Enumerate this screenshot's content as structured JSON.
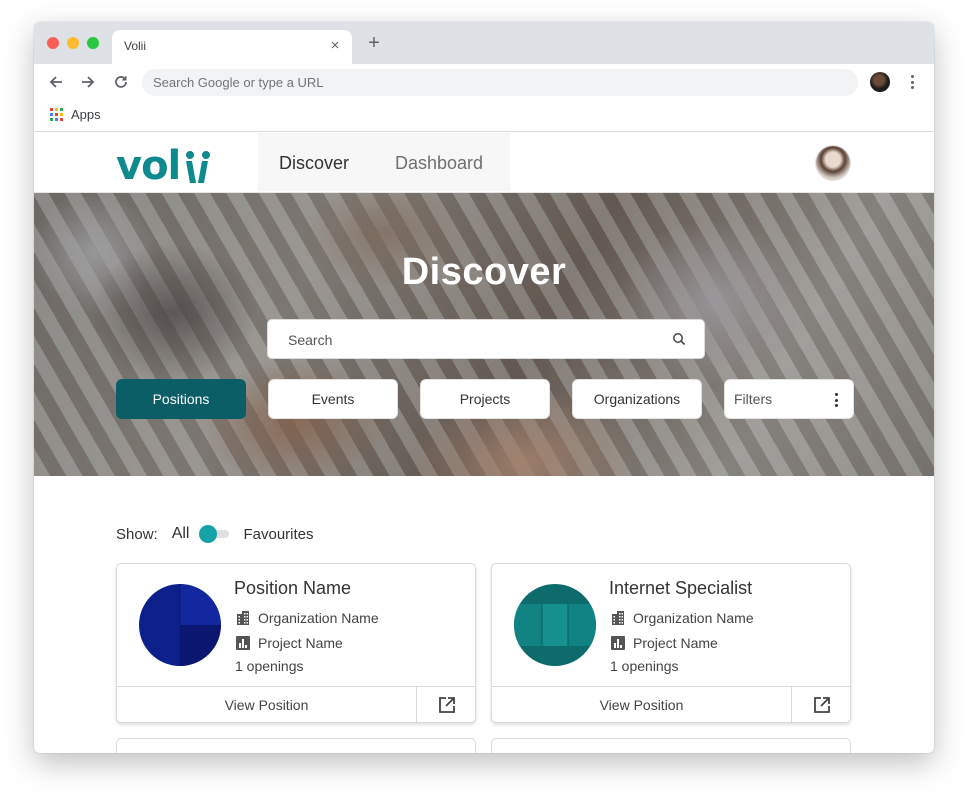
{
  "browser": {
    "tab_title": "Volii",
    "tab_close": "×",
    "new_tab": "+",
    "omnibox_placeholder": "Search Google or type a URL",
    "bookmarks": {
      "apps_label": "Apps"
    }
  },
  "site": {
    "logo_text": "volii",
    "brand_color": "#0e8a8f",
    "nav": {
      "discover": "Discover",
      "dashboard": "Dashboard"
    }
  },
  "hero": {
    "title": "Discover",
    "search_placeholder": "Search",
    "filters": {
      "positions": "Positions",
      "events": "Events",
      "projects": "Projects",
      "organizations": "Organizations",
      "filters": "Filters"
    },
    "active_filter": "positions",
    "active_color": "#0b5e66"
  },
  "show": {
    "label": "Show:",
    "all": "All",
    "favourites": "Favourites",
    "toggle_color": "#17a3a6"
  },
  "cards": [
    {
      "title": "Position Name",
      "organization": "Organization Name",
      "project": "Project Name",
      "openings": "1  openings",
      "view_label": "View Position",
      "image_color": "#0d1f8a"
    },
    {
      "title": "Internet Specialist",
      "organization": "Organization Name",
      "project": "Project Name",
      "openings": "1  openings",
      "view_label": "View Position",
      "image_color": "#0d6b6b"
    }
  ]
}
